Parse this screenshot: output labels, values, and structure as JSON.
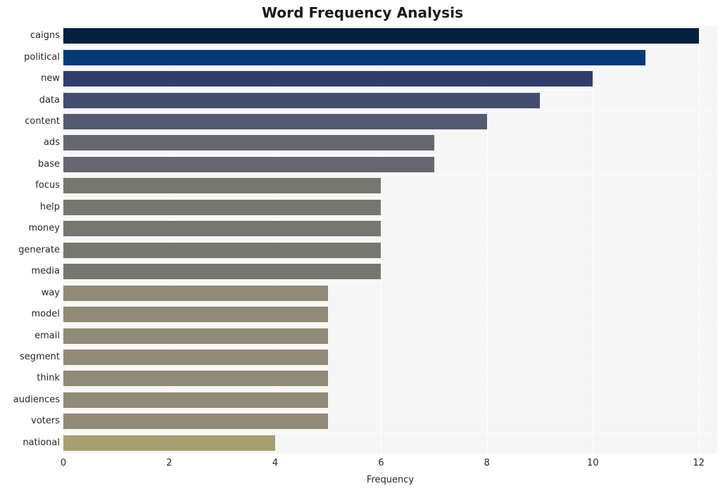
{
  "chart_data": {
    "type": "bar",
    "orientation": "horizontal",
    "title": "Word Frequency Analysis",
    "xlabel": "Frequency",
    "ylabel": "",
    "xlim": [
      0,
      12.35
    ],
    "xticks": [
      0,
      2,
      4,
      6,
      8,
      10,
      12
    ],
    "xtick_labels": [
      "0",
      "2",
      "4",
      "6",
      "8",
      "10",
      "12"
    ],
    "grid": true,
    "legend": null,
    "categories": [
      "caigns",
      "political",
      "new",
      "data",
      "content",
      "ads",
      "base",
      "focus",
      "help",
      "money",
      "generate",
      "media",
      "way",
      "model",
      "email",
      "segment",
      "think",
      "audiences",
      "voters",
      "national"
    ],
    "values": [
      12,
      11,
      10,
      9,
      8,
      7,
      7,
      6,
      6,
      6,
      6,
      6,
      5,
      5,
      5,
      5,
      5,
      5,
      5,
      4
    ],
    "bar_colors": [
      "#04203f",
      "#053a78",
      "#2f3f6e",
      "#434d70",
      "#555a73",
      "#66676f",
      "#66676f",
      "#77776f",
      "#77776f",
      "#77776f",
      "#77776f",
      "#77776f",
      "#908b74",
      "#908b74",
      "#908b74",
      "#908b74",
      "#908b74",
      "#908b74",
      "#908b74",
      "#a6a071"
    ],
    "plot_background": "#f6f6f6",
    "gridline_color": "#ffffff",
    "title_color": "#1a1a1a"
  }
}
